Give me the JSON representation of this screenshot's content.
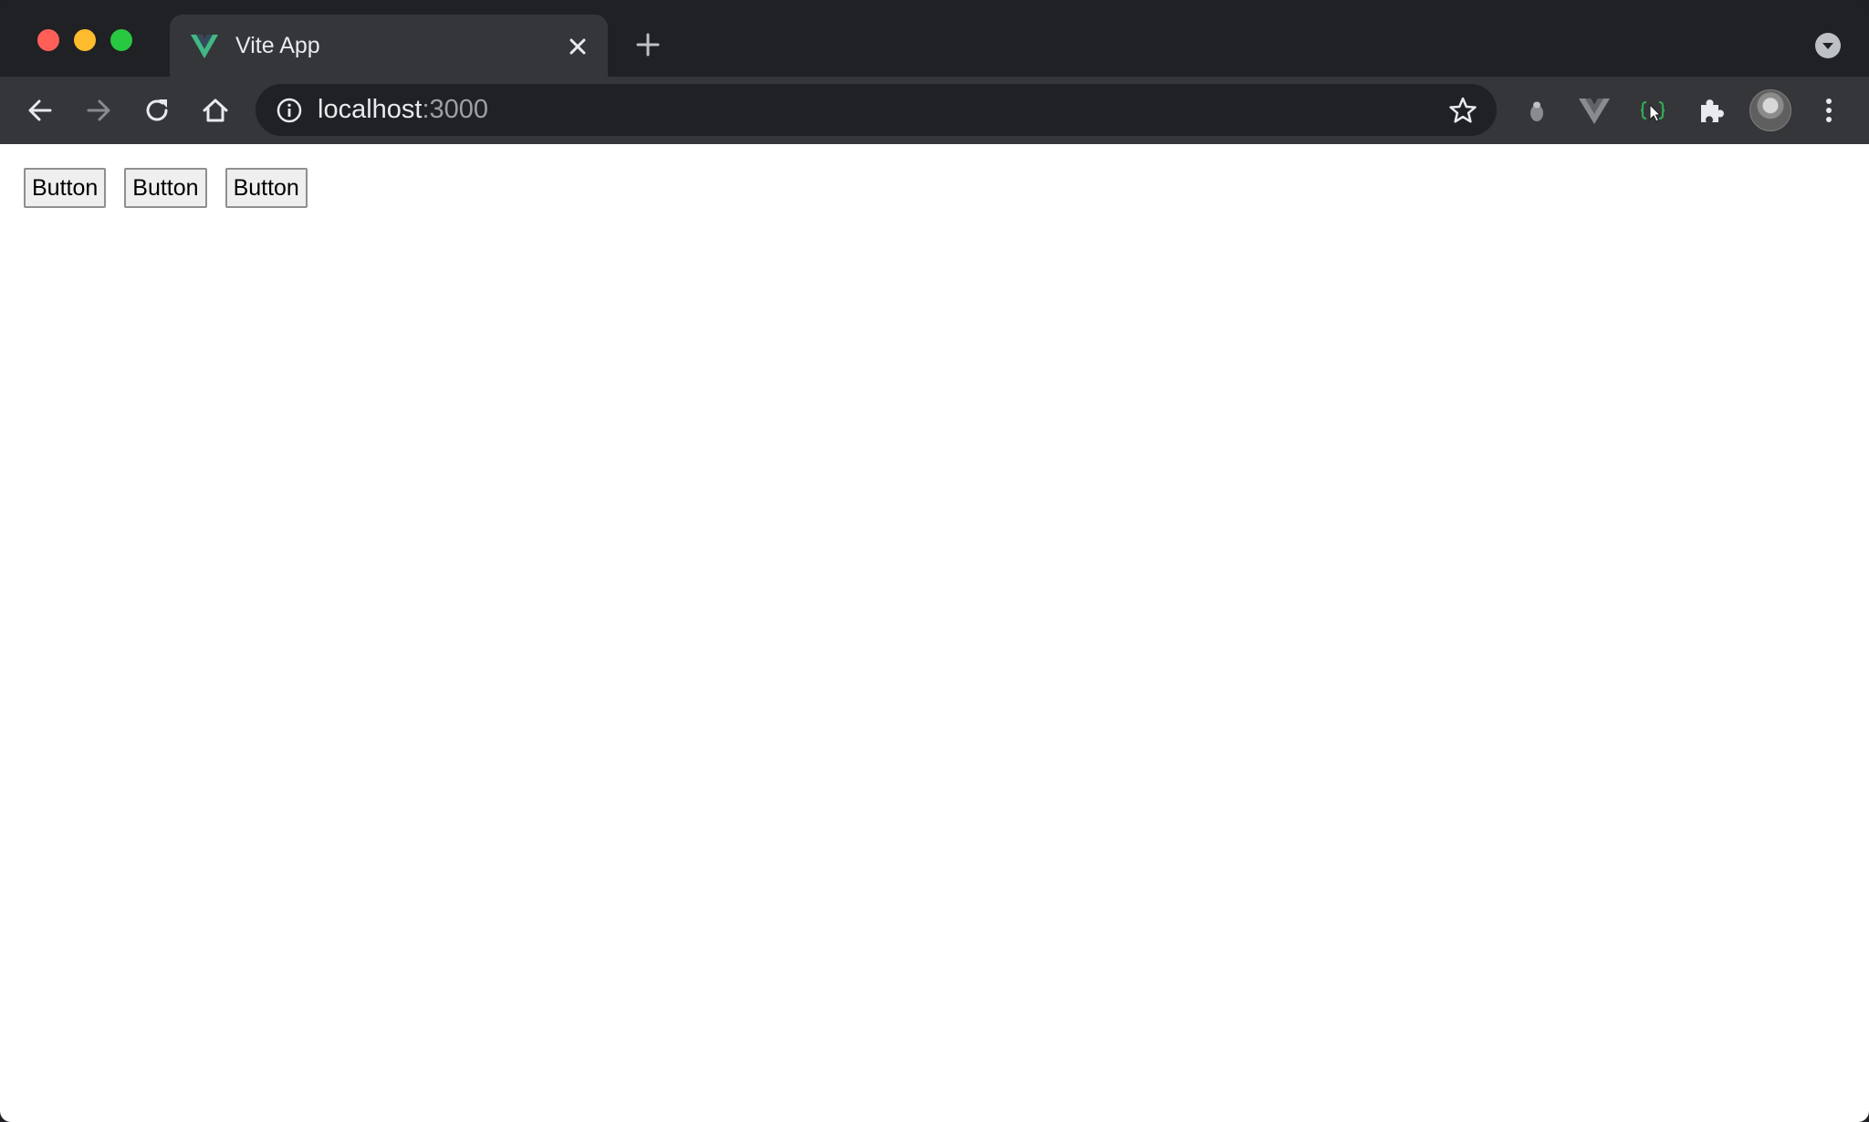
{
  "browser": {
    "tab": {
      "title": "Vite App",
      "favicon": "vue-logo-icon"
    },
    "address_bar": {
      "host": "localhost",
      "port": ":3000"
    },
    "colors": {
      "frame": "#202124",
      "toolbar": "#35363a",
      "vue_green": "#41b883",
      "vue_dark": "#34495e"
    }
  },
  "page": {
    "buttons": [
      {
        "label": "Button"
      },
      {
        "label": "Button"
      },
      {
        "label": "Button"
      }
    ]
  }
}
